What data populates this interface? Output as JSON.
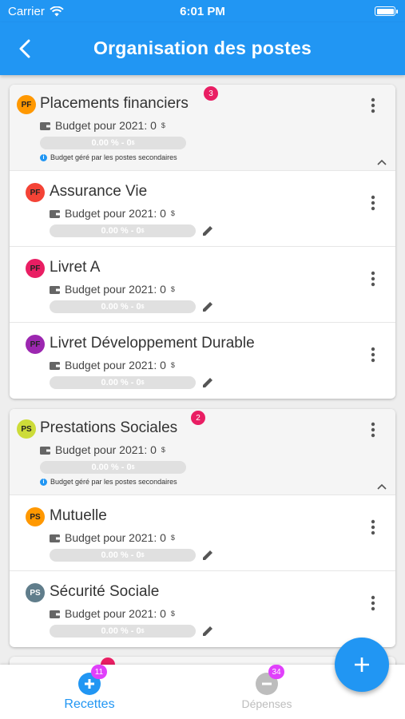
{
  "status_bar": {
    "carrier": "Carrier",
    "time": "6:01 PM"
  },
  "app_bar": {
    "title": "Organisation des postes"
  },
  "colors": {
    "primary": "#2196f3",
    "badge": "#e91e63",
    "counter": "#e040fb"
  },
  "groups": [
    {
      "initials": "PF",
      "name": "Placements financiers",
      "count": "3",
      "color": "#ff9800",
      "budget_label": "Budget pour 2021: 0",
      "currency": "$",
      "progress": "0.00 % - 0",
      "progress_unit": "$",
      "note": "Budget géré par les postes secondaires",
      "items": [
        {
          "initials": "PF",
          "name": "Assurance Vie",
          "color": "#f44336",
          "budget_label": "Budget pour 2021: 0",
          "currency": "$",
          "progress": "0.00 % - 0",
          "progress_unit": "$"
        },
        {
          "initials": "PF",
          "name": "Livret A",
          "color": "#e91e63",
          "budget_label": "Budget pour 2021: 0",
          "currency": "$",
          "progress": "0.00 % - 0",
          "progress_unit": "$"
        },
        {
          "initials": "PF",
          "name": "Livret Développement Durable",
          "color": "#9c27b0",
          "budget_label": "Budget pour 2021: 0",
          "currency": "$",
          "progress": "0.00 % - 0",
          "progress_unit": "$"
        }
      ]
    },
    {
      "initials": "PS",
      "name": "Prestations Sociales",
      "count": "2",
      "color": "#cddc39",
      "budget_label": "Budget pour 2021: 0",
      "currency": "$",
      "progress": "0.00 % - 0",
      "progress_unit": "$",
      "note": "Budget géré par les postes secondaires",
      "items": [
        {
          "initials": "PS",
          "name": "Mutuelle",
          "color": "#ff9800",
          "budget_label": "Budget pour 2021: 0",
          "currency": "$",
          "progress": "0.00 % - 0",
          "progress_unit": "$"
        },
        {
          "initials": "PS",
          "name": "Sécurité Sociale",
          "color": "#607d8b",
          "budget_label": "Budget pour 2021: 0",
          "currency": "$",
          "progress": "0.00 % - 0",
          "progress_unit": "$"
        }
      ]
    }
  ],
  "bottom_nav": [
    {
      "label": "Recettes",
      "count": "11",
      "active": true,
      "icon": "add-circle-icon"
    },
    {
      "label": "Dépenses",
      "count": "34",
      "active": false,
      "icon": "remove-circle-icon"
    }
  ],
  "fab": {
    "icon": "plus-icon"
  }
}
